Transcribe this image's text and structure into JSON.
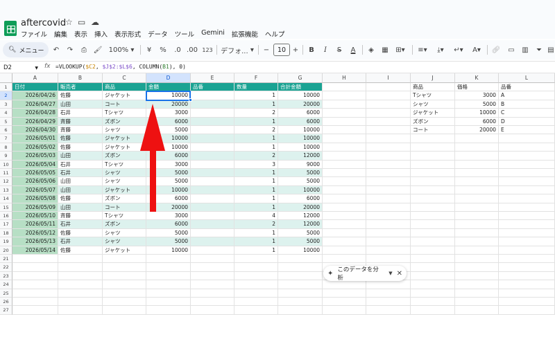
{
  "app": {
    "title": "aftercovid",
    "menu": [
      "ファイル",
      "編集",
      "表示",
      "挿入",
      "表示形式",
      "データ",
      "ツール",
      "Gemini",
      "拡張機能",
      "ヘルプ"
    ]
  },
  "toolbar": {
    "menu_search_label": "メニュー",
    "zoom": "100%",
    "currency": "¥",
    "percent": "%",
    "dec_decrease": ".0",
    "dec_increase": ".00",
    "number_format": "123",
    "font": "デフォ...",
    "font_size": "10"
  },
  "formula_bar": {
    "name_box": "D2",
    "formula_prefix": "=VLOOKUP(",
    "formula_ref1": "$C2",
    "formula_sep1": ", ",
    "formula_ref2": "$J$2:$L$6",
    "formula_sep2": ", COLUMN(",
    "formula_ref3": "B1",
    "formula_suffix": "), 0)"
  },
  "columns": [
    "A",
    "B",
    "C",
    "D",
    "E",
    "F",
    "G",
    "H",
    "I",
    "J",
    "K",
    "L"
  ],
  "row_numbers": [
    "1",
    "2",
    "3",
    "4",
    "5",
    "6",
    "7",
    "8",
    "9",
    "10",
    "11",
    "12",
    "13",
    "14",
    "15",
    "16",
    "17",
    "18",
    "19",
    "20",
    "21",
    "22",
    "23",
    "24",
    "25",
    "26",
    "27"
  ],
  "main_table": {
    "headers": [
      "日付",
      "販売者",
      "商品",
      "金額",
      "品番",
      "数量",
      "合計金額"
    ],
    "rows": [
      [
        "2026/04/26",
        "佐藤",
        "ジャケット",
        "10000",
        "",
        "1",
        "10000"
      ],
      [
        "2026/04/27",
        "山田",
        "コート",
        "20000",
        "",
        "1",
        "20000"
      ],
      [
        "2026/04/28",
        "石井",
        "Tシャツ",
        "3000",
        "",
        "2",
        "6000"
      ],
      [
        "2026/04/29",
        "斉藤",
        "ズボン",
        "6000",
        "",
        "1",
        "6000"
      ],
      [
        "2026/04/30",
        "斉藤",
        "シャツ",
        "5000",
        "",
        "2",
        "10000"
      ],
      [
        "2026/05/01",
        "佐藤",
        "ジャケット",
        "10000",
        "",
        "1",
        "10000"
      ],
      [
        "2026/05/02",
        "佐藤",
        "ジャケット",
        "10000",
        "",
        "1",
        "10000"
      ],
      [
        "2026/05/03",
        "山田",
        "ズボン",
        "6000",
        "",
        "2",
        "12000"
      ],
      [
        "2026/05/04",
        "石井",
        "Tシャツ",
        "3000",
        "",
        "3",
        "9000"
      ],
      [
        "2026/05/05",
        "石井",
        "シャツ",
        "5000",
        "",
        "1",
        "5000"
      ],
      [
        "2026/05/06",
        "山田",
        "シャツ",
        "5000",
        "",
        "1",
        "5000"
      ],
      [
        "2026/05/07",
        "山田",
        "ジャケット",
        "10000",
        "",
        "1",
        "10000"
      ],
      [
        "2026/05/08",
        "佐藤",
        "ズボン",
        "6000",
        "",
        "1",
        "6000"
      ],
      [
        "2026/05/09",
        "山田",
        "コート",
        "20000",
        "",
        "1",
        "20000"
      ],
      [
        "2026/05/10",
        "斉藤",
        "Tシャツ",
        "3000",
        "",
        "4",
        "12000"
      ],
      [
        "2026/05/11",
        "石井",
        "ズボン",
        "6000",
        "",
        "2",
        "12000"
      ],
      [
        "2026/05/12",
        "佐藤",
        "シャツ",
        "5000",
        "",
        "1",
        "5000"
      ],
      [
        "2026/05/13",
        "石井",
        "シャツ",
        "5000",
        "",
        "1",
        "5000"
      ],
      [
        "2026/05/14",
        "佐藤",
        "ジャケット",
        "10000",
        "",
        "1",
        "10000"
      ]
    ]
  },
  "lookup_table": {
    "headers": [
      "商品",
      "価格",
      "品番"
    ],
    "rows": [
      [
        "Tシャツ",
        "3000",
        "A"
      ],
      [
        "シャツ",
        "5000",
        "B"
      ],
      [
        "ジャケット",
        "10000",
        "C"
      ],
      [
        "ズボン",
        "6000",
        "D"
      ],
      [
        "コート",
        "20000",
        "E"
      ]
    ]
  },
  "explore_chip": {
    "label": "このデータを分析"
  },
  "colors": {
    "header_teal": "#1aa393",
    "date_green": "#b7dfc5",
    "band": "#ddf2ee",
    "active": "#1a73e8",
    "arrow": "#ee1111"
  }
}
